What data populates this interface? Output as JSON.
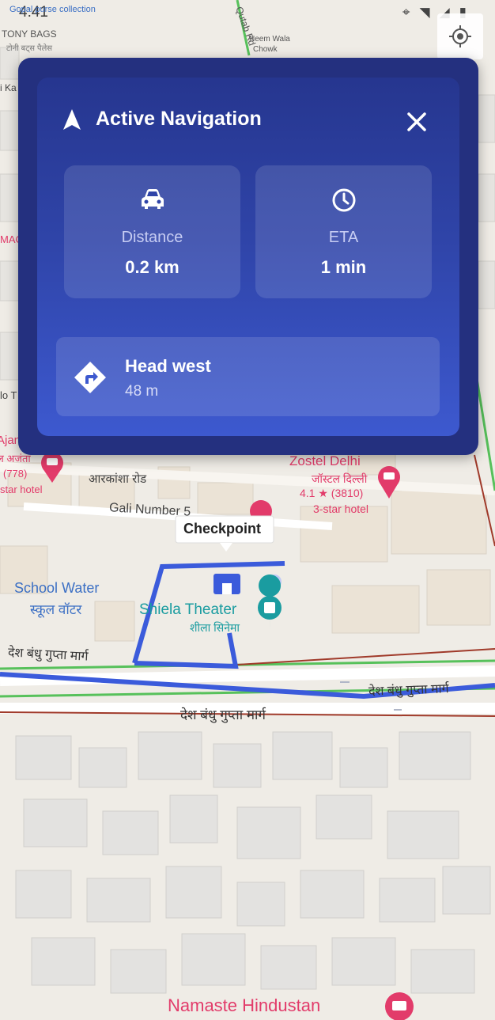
{
  "status_bar": {
    "time": "4:41",
    "icons": [
      "alert-icon",
      "dnd-icon",
      "location-icon",
      "wifi-icon",
      "signal-icon",
      "battery-icon"
    ]
  },
  "map": {
    "labels": {
      "gopal": "Gopal purse collection",
      "tony_bags": "TONY BAGS",
      "tony_bags_hi": "टोनी बट्स पैलेस",
      "qutab_rd": "Qutab Rd",
      "neem_wala": "Neem Wala",
      "chowk": "Chowk",
      "ajanta": "Ajanta",
      "ajanta_hi": "ल अजंता",
      "rating_left": "(778)",
      "star_hotel_left": "star hotel",
      "arakasha": "आरकांशा रोड",
      "zostel": "Zostel Delhi",
      "zostel_hi": "जॉस्टल दिल्ली",
      "zostel_rating": "4.1 ★ (3810)",
      "zostel_type": "3-star hotel",
      "gali": "Gali Number 5",
      "checkpoint": "Checkpoint",
      "school_water": "School Water",
      "school_water_hi": "स्कूल वॉटर",
      "sheila": "Shiela Theater",
      "sheila_hi": "शीला सिनेमा",
      "desh_bandhu_1": "देश बंधु गुप्ता मार्ग",
      "desh_bandhu_2": "देश बंधु गुप्ता मार्ग",
      "desh_bandhu_3": "देश बंधु गुप्ता मार्ग",
      "namaste": "Namaste Hindustan",
      "edge_ka": "i Ka",
      "edge_mac": "MAC",
      "edge_lo": "lo T"
    },
    "colors": {
      "route": "#3b5bdb",
      "road_green": "#57c15b",
      "road_red": "#a03a2a",
      "poi_pink": "#e23b6a",
      "poi_teal": "#1a9ca0",
      "label_blue": "#3b6fc4"
    }
  },
  "navigation": {
    "title": "Active Navigation",
    "distance": {
      "label": "Distance",
      "value": "0.2 km"
    },
    "eta": {
      "label": "ETA",
      "value": "1 min"
    },
    "instruction": {
      "text": "Head west",
      "distance": "48 m"
    },
    "colors": {
      "panel": "#24307f",
      "card_top": "#26368f",
      "card_bottom": "#3d59cf"
    }
  }
}
